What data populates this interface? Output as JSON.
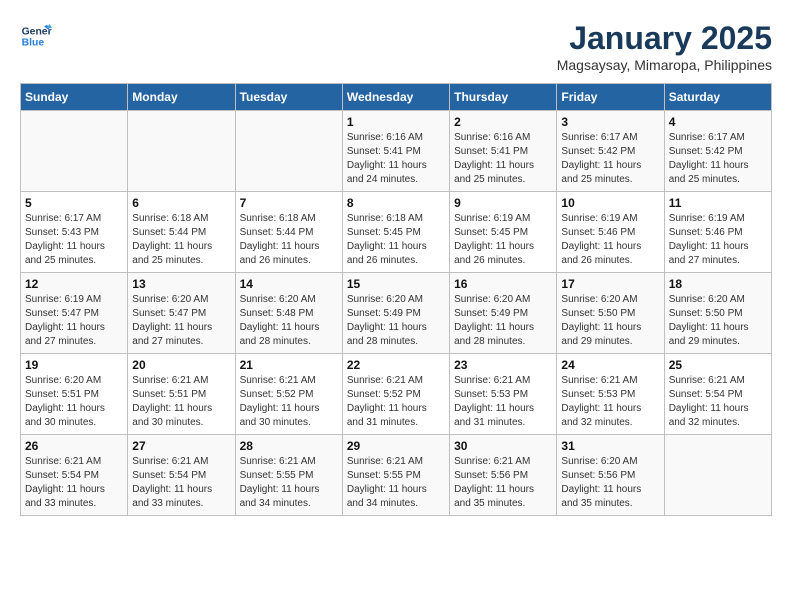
{
  "header": {
    "logo_line1": "General",
    "logo_line2": "Blue",
    "month": "January 2025",
    "location": "Magsaysay, Mimaropa, Philippines"
  },
  "weekdays": [
    "Sunday",
    "Monday",
    "Tuesday",
    "Wednesday",
    "Thursday",
    "Friday",
    "Saturday"
  ],
  "weeks": [
    [
      {
        "day": "",
        "info": ""
      },
      {
        "day": "",
        "info": ""
      },
      {
        "day": "",
        "info": ""
      },
      {
        "day": "1",
        "info": "Sunrise: 6:16 AM\nSunset: 5:41 PM\nDaylight: 11 hours\nand 24 minutes."
      },
      {
        "day": "2",
        "info": "Sunrise: 6:16 AM\nSunset: 5:41 PM\nDaylight: 11 hours\nand 25 minutes."
      },
      {
        "day": "3",
        "info": "Sunrise: 6:17 AM\nSunset: 5:42 PM\nDaylight: 11 hours\nand 25 minutes."
      },
      {
        "day": "4",
        "info": "Sunrise: 6:17 AM\nSunset: 5:42 PM\nDaylight: 11 hours\nand 25 minutes."
      }
    ],
    [
      {
        "day": "5",
        "info": "Sunrise: 6:17 AM\nSunset: 5:43 PM\nDaylight: 11 hours\nand 25 minutes."
      },
      {
        "day": "6",
        "info": "Sunrise: 6:18 AM\nSunset: 5:44 PM\nDaylight: 11 hours\nand 25 minutes."
      },
      {
        "day": "7",
        "info": "Sunrise: 6:18 AM\nSunset: 5:44 PM\nDaylight: 11 hours\nand 26 minutes."
      },
      {
        "day": "8",
        "info": "Sunrise: 6:18 AM\nSunset: 5:45 PM\nDaylight: 11 hours\nand 26 minutes."
      },
      {
        "day": "9",
        "info": "Sunrise: 6:19 AM\nSunset: 5:45 PM\nDaylight: 11 hours\nand 26 minutes."
      },
      {
        "day": "10",
        "info": "Sunrise: 6:19 AM\nSunset: 5:46 PM\nDaylight: 11 hours\nand 26 minutes."
      },
      {
        "day": "11",
        "info": "Sunrise: 6:19 AM\nSunset: 5:46 PM\nDaylight: 11 hours\nand 27 minutes."
      }
    ],
    [
      {
        "day": "12",
        "info": "Sunrise: 6:19 AM\nSunset: 5:47 PM\nDaylight: 11 hours\nand 27 minutes."
      },
      {
        "day": "13",
        "info": "Sunrise: 6:20 AM\nSunset: 5:47 PM\nDaylight: 11 hours\nand 27 minutes."
      },
      {
        "day": "14",
        "info": "Sunrise: 6:20 AM\nSunset: 5:48 PM\nDaylight: 11 hours\nand 28 minutes."
      },
      {
        "day": "15",
        "info": "Sunrise: 6:20 AM\nSunset: 5:49 PM\nDaylight: 11 hours\nand 28 minutes."
      },
      {
        "day": "16",
        "info": "Sunrise: 6:20 AM\nSunset: 5:49 PM\nDaylight: 11 hours\nand 28 minutes."
      },
      {
        "day": "17",
        "info": "Sunrise: 6:20 AM\nSunset: 5:50 PM\nDaylight: 11 hours\nand 29 minutes."
      },
      {
        "day": "18",
        "info": "Sunrise: 6:20 AM\nSunset: 5:50 PM\nDaylight: 11 hours\nand 29 minutes."
      }
    ],
    [
      {
        "day": "19",
        "info": "Sunrise: 6:20 AM\nSunset: 5:51 PM\nDaylight: 11 hours\nand 30 minutes."
      },
      {
        "day": "20",
        "info": "Sunrise: 6:21 AM\nSunset: 5:51 PM\nDaylight: 11 hours\nand 30 minutes."
      },
      {
        "day": "21",
        "info": "Sunrise: 6:21 AM\nSunset: 5:52 PM\nDaylight: 11 hours\nand 30 minutes."
      },
      {
        "day": "22",
        "info": "Sunrise: 6:21 AM\nSunset: 5:52 PM\nDaylight: 11 hours\nand 31 minutes."
      },
      {
        "day": "23",
        "info": "Sunrise: 6:21 AM\nSunset: 5:53 PM\nDaylight: 11 hours\nand 31 minutes."
      },
      {
        "day": "24",
        "info": "Sunrise: 6:21 AM\nSunset: 5:53 PM\nDaylight: 11 hours\nand 32 minutes."
      },
      {
        "day": "25",
        "info": "Sunrise: 6:21 AM\nSunset: 5:54 PM\nDaylight: 11 hours\nand 32 minutes."
      }
    ],
    [
      {
        "day": "26",
        "info": "Sunrise: 6:21 AM\nSunset: 5:54 PM\nDaylight: 11 hours\nand 33 minutes."
      },
      {
        "day": "27",
        "info": "Sunrise: 6:21 AM\nSunset: 5:54 PM\nDaylight: 11 hours\nand 33 minutes."
      },
      {
        "day": "28",
        "info": "Sunrise: 6:21 AM\nSunset: 5:55 PM\nDaylight: 11 hours\nand 34 minutes."
      },
      {
        "day": "29",
        "info": "Sunrise: 6:21 AM\nSunset: 5:55 PM\nDaylight: 11 hours\nand 34 minutes."
      },
      {
        "day": "30",
        "info": "Sunrise: 6:21 AM\nSunset: 5:56 PM\nDaylight: 11 hours\nand 35 minutes."
      },
      {
        "day": "31",
        "info": "Sunrise: 6:20 AM\nSunset: 5:56 PM\nDaylight: 11 hours\nand 35 minutes."
      },
      {
        "day": "",
        "info": ""
      }
    ]
  ]
}
